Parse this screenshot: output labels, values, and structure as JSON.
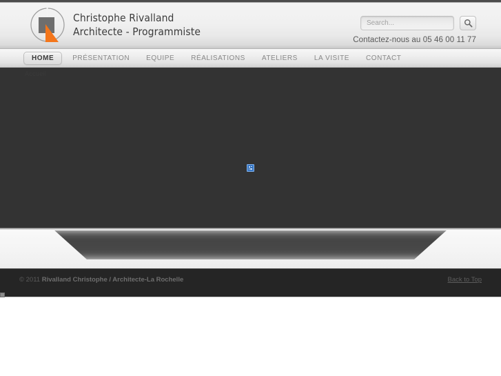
{
  "site": {
    "brand_line1": "Christophe Rivalland",
    "brand_line2": "Architecte - Programmiste",
    "logo_icon": "architect-circle-square-triangle-logo",
    "accent_color": "#f4761b",
    "logo_gray": "#6e6e6e"
  },
  "search": {
    "placeholder": "Search...",
    "value": "",
    "button_icon": "search-icon"
  },
  "contact": {
    "text": "Contactez-nous au 05 46 00 11 77"
  },
  "nav": {
    "items": [
      {
        "label": "HOME",
        "active": true
      },
      {
        "label": "PRÉSENTATION",
        "active": false
      },
      {
        "label": "EQUIPE",
        "active": false
      },
      {
        "label": "RÉALISATIONS",
        "active": false
      },
      {
        "label": "ATELIERS",
        "active": false
      },
      {
        "label": "LA VISITE",
        "active": false
      },
      {
        "label": "CONTACT",
        "active": false
      }
    ]
  },
  "stage": {
    "ghost_label": "Accueil",
    "background_color": "#333333",
    "placeholder_icon": "missing-plugin-icon"
  },
  "footer": {
    "copyright_prefix": "© 2011 ",
    "copyright_strong": "Rivalland Christophe / Architecte-La Rochelle",
    "back_to_top": "Back to Top"
  }
}
